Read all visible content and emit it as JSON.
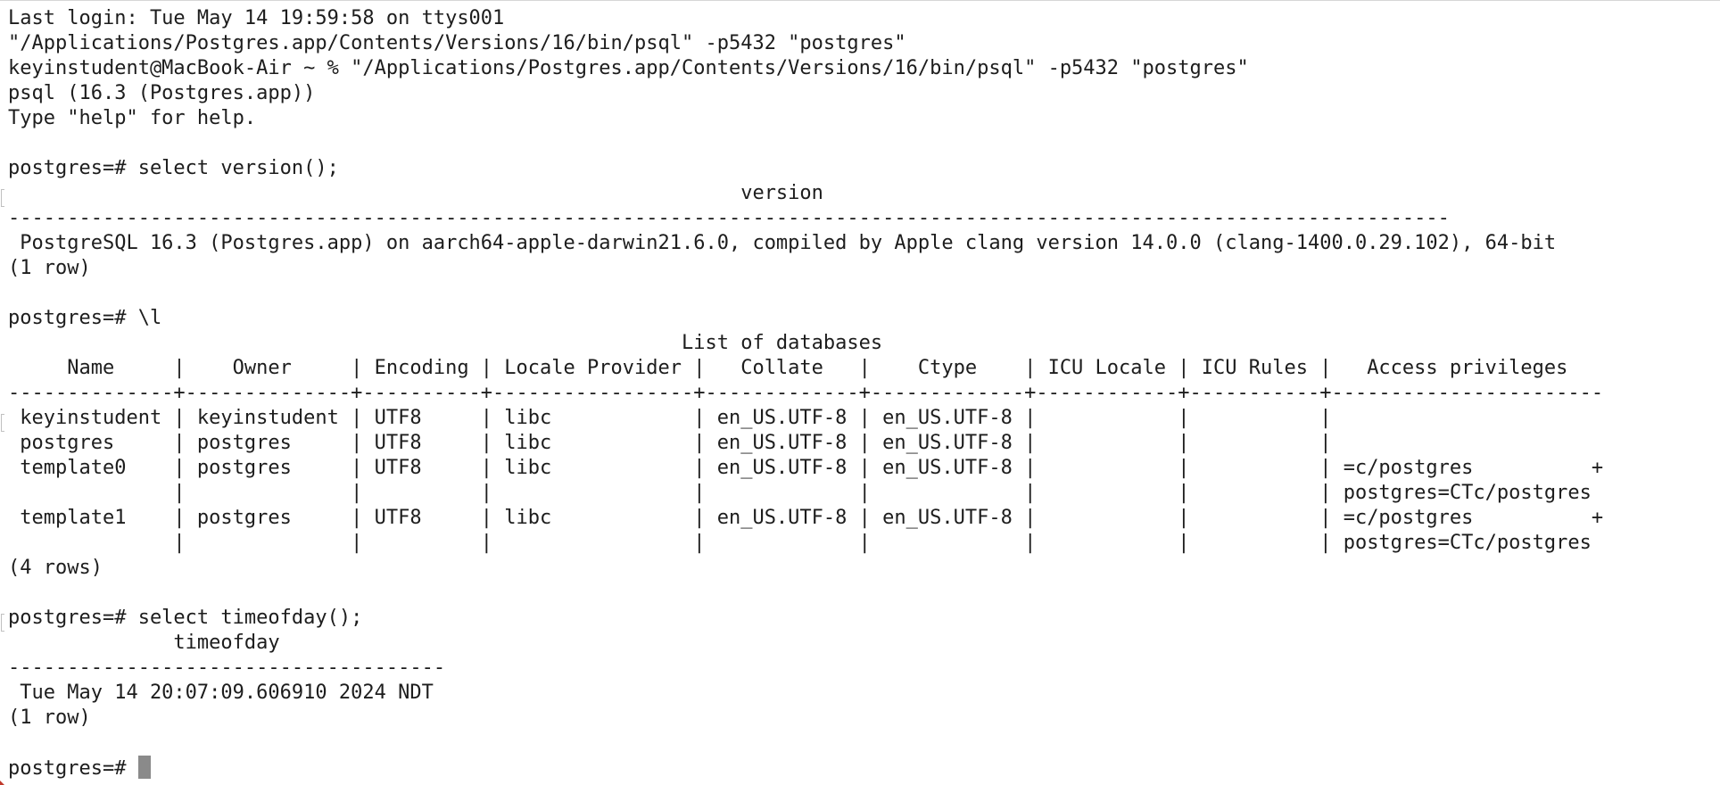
{
  "terminal": {
    "lines": [
      "Last login: Tue May 14 19:59:58 on ttys001",
      "\"/Applications/Postgres.app/Contents/Versions/16/bin/psql\" -p5432 \"postgres\"",
      "keyinstudent@MacBook-Air ~ % \"/Applications/Postgres.app/Contents/Versions/16/bin/psql\" -p5432 \"postgres\"",
      "psql (16.3 (Postgres.app))",
      "Type \"help\" for help.",
      "",
      "postgres=# select version();",
      "                                                              version",
      "--------------------------------------------------------------------------------------------------------------------------",
      " PostgreSQL 16.3 (Postgres.app) on aarch64-apple-darwin21.6.0, compiled by Apple clang version 14.0.0 (clang-1400.0.29.102), 64-bit",
      "(1 row)",
      "",
      "postgres=# \\l",
      "                                                         List of databases",
      "     Name     |    Owner     | Encoding | Locale Provider |   Collate   |    Ctype    | ICU Locale | ICU Rules |   Access privileges",
      "--------------+--------------+----------+-----------------+-------------+-------------+------------+-----------+-----------------------",
      " keyinstudent | keyinstudent | UTF8     | libc            | en_US.UTF-8 | en_US.UTF-8 |            |           |",
      " postgres     | postgres     | UTF8     | libc            | en_US.UTF-8 | en_US.UTF-8 |            |           |",
      " template0    | postgres     | UTF8     | libc            | en_US.UTF-8 | en_US.UTF-8 |            |           | =c/postgres          +",
      "              |              |          |                 |             |             |            |           | postgres=CTc/postgres",
      " template1    | postgres     | UTF8     | libc            | en_US.UTF-8 | en_US.UTF-8 |            |           | =c/postgres          +",
      "              |              |          |                 |             |             |            |           | postgres=CTc/postgres",
      "(4 rows)",
      "",
      "postgres=# select timeofday();",
      "              timeofday",
      "-------------------------------------",
      " Tue May 14 20:07:09.606910 2024 NDT",
      "(1 row)",
      "",
      "postgres=# "
    ]
  }
}
